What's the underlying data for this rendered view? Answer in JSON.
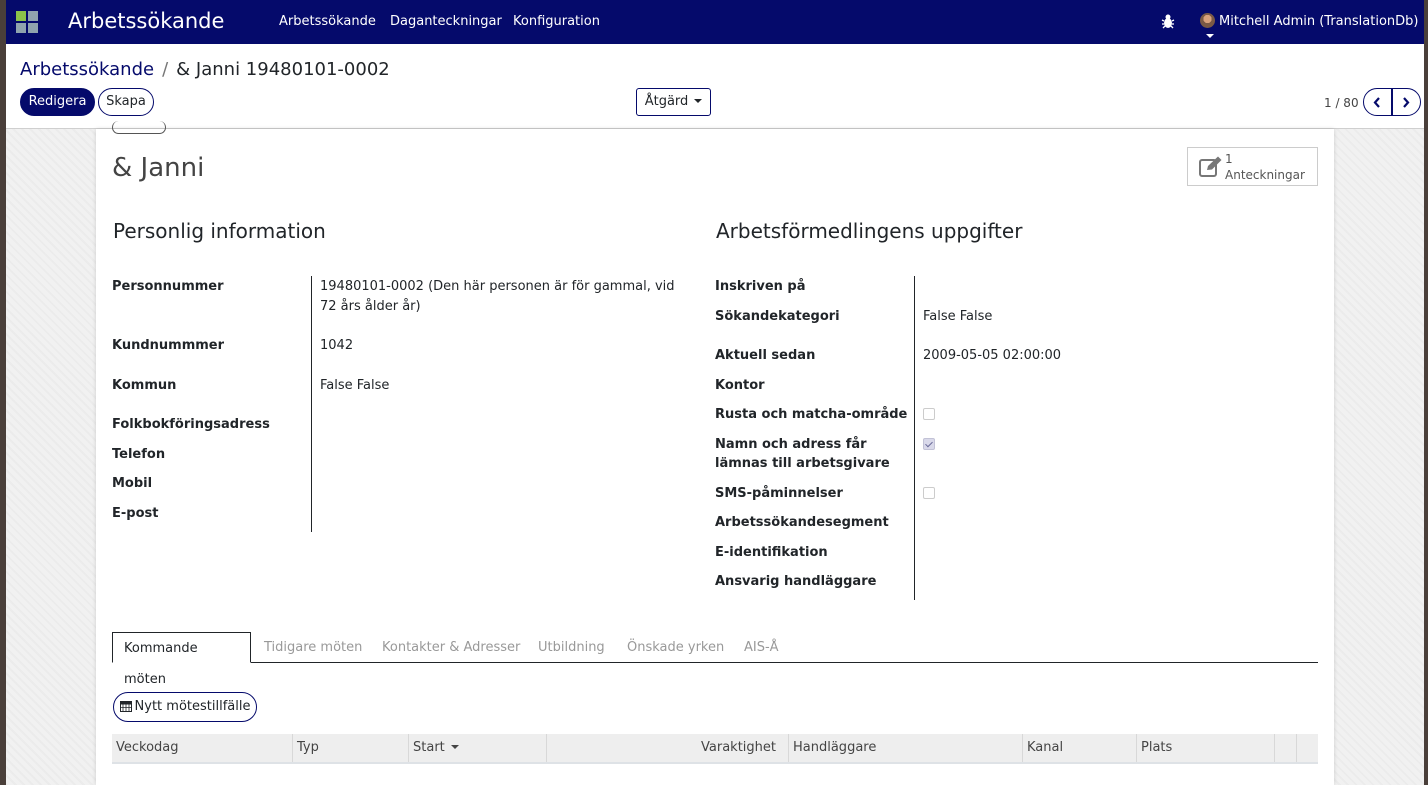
{
  "navbar": {
    "app_title": "Arbetssökande",
    "menu": [
      "Arbetssökande",
      "Daganteckningar",
      "Konfiguration"
    ],
    "user": "Mitchell Admin (TranslationDb)"
  },
  "breadcrumb": {
    "parent": "Arbetssökande",
    "separator": "/",
    "current": "& Janni 19480101-0002"
  },
  "actions": {
    "edit": "Redigera",
    "create": "Skapa",
    "action": "Åtgärd"
  },
  "pager": {
    "value": "1 / 80"
  },
  "record": {
    "title": "& Janni",
    "notes_count": "1",
    "notes_label": "Anteckningar"
  },
  "personal": {
    "title": "Personlig information",
    "fields": [
      {
        "label": "Personnummer",
        "value": "19480101-0002 (Den här personen är för gammal, vid 72 års ålder år)"
      },
      {
        "label": "Kundnummmer",
        "value": "1042"
      },
      {
        "label": "Kommun",
        "value": "False False"
      },
      {
        "label": "Folkbokföringsadress",
        "value": ""
      },
      {
        "label": "Telefon",
        "value": ""
      },
      {
        "label": "Mobil",
        "value": ""
      },
      {
        "label": "E-post",
        "value": ""
      }
    ]
  },
  "employment": {
    "title": "Arbetsförmedlingens uppgifter",
    "fields": [
      {
        "label": "Inskriven på",
        "value": ""
      },
      {
        "label": "Sökandekategori",
        "value": "False False"
      },
      {
        "label": "Aktuell sedan",
        "value": "2009-05-05 02:00:00"
      },
      {
        "label": "Kontor",
        "value": ""
      },
      {
        "label": "Rusta och matcha-område",
        "checked": false
      },
      {
        "label": "Namn och adress får lämnas till arbetsgivare",
        "checked": true
      },
      {
        "label": "SMS-påminnelser",
        "checked": false
      },
      {
        "label": "Arbetssökandesegment",
        "value": ""
      },
      {
        "label": "E-identifikation",
        "value": ""
      },
      {
        "label": "Ansvarig handläggare",
        "value": ""
      }
    ]
  },
  "tabs": [
    "Kommande möten",
    "Tidigare möten",
    "Kontakter & Adresser",
    "Utbildning",
    "Önskade yrken",
    "AIS-Å"
  ],
  "meetings": {
    "new_button": "Nytt mötestillfälle",
    "columns": [
      "Veckodag",
      "Typ",
      "Start",
      "Varaktighet",
      "Handläggare",
      "Kanal",
      "Plats"
    ]
  }
}
